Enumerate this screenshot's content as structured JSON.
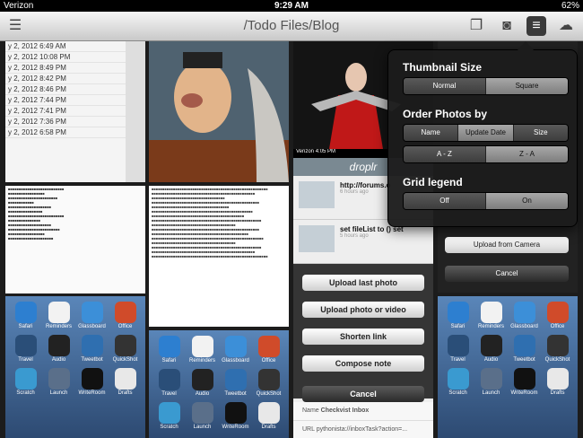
{
  "status": {
    "carrier": "Verizon",
    "time": "9:29 AM",
    "battery": "62%"
  },
  "nav": {
    "title": "/Todo Files/Blog"
  },
  "tiles": {
    "list_dates": [
      "y 2, 2012 6:49 AM",
      "y 2, 2012 10:08 PM",
      "y 2, 2012 8:49 PM",
      "y 2, 2012 8:42 PM",
      "y 2, 2012 8:46 PM",
      "y 2, 2012 7:44 PM",
      "y 2, 2012 7:41 PM",
      "y 2, 2012 7:36 PM",
      "y 2, 2012 6:58 PM"
    ],
    "dropir": {
      "carrier": "Verizon",
      "time": "4:05 PM",
      "title": "droplr",
      "items": [
        {
          "title": "http://forums.o",
          "sub": "6 hours ago"
        },
        {
          "title": "set fileList to () set",
          "sub": "5 hours ago"
        }
      ],
      "sheet_buttons": [
        "Upload last photo",
        "Upload photo or video",
        "Shorten link",
        "Compose note"
      ],
      "cancel": "Cancel",
      "name_label": "Name",
      "name_value": "Checkvist Inbox",
      "url_label": "URL",
      "url_value": "pythonista://inboxTask?action=..."
    },
    "camera": {
      "upload": "Upload from Camera",
      "cancel": "Cancel"
    }
  },
  "homescreen": {
    "apps": [
      "Safari",
      "Reminders",
      "Glassboard",
      "Office",
      "Travel",
      "Audio",
      "Tweetbot",
      "QuickShot",
      "Scratch",
      "Launch",
      "WriteRoom",
      "Drafts"
    ]
  },
  "popover": {
    "thumb_title": "Thumbnail Size",
    "thumb_options": [
      "Normal",
      "Square"
    ],
    "order_title": "Order Photos by",
    "order_options": [
      "Name",
      "Update Date",
      "Size"
    ],
    "order_alpha": [
      "A - Z",
      "Z - A"
    ],
    "grid_title": "Grid legend",
    "grid_options": [
      "Off",
      "On"
    ]
  },
  "colors": {
    "selected": "#9a9a9a",
    "popover_bg": "#1c1c1c"
  }
}
